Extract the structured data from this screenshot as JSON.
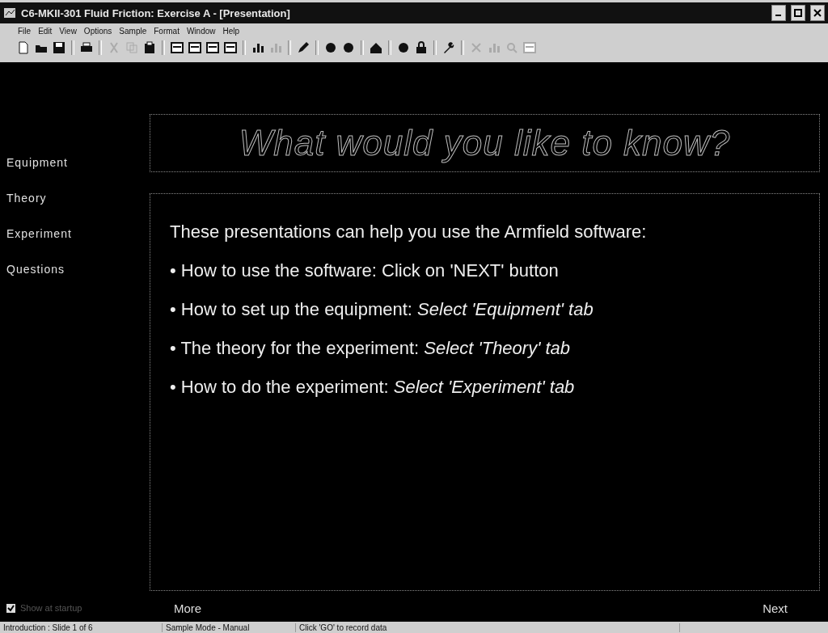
{
  "window": {
    "title": "C6-MKII-301 Fluid Friction:  Exercise A - [Presentation]"
  },
  "menu": [
    "File",
    "Edit",
    "View",
    "Options",
    "Sample",
    "Format",
    "Window",
    "Help"
  ],
  "toolbar": [
    {
      "kind": "page",
      "disabled": false
    },
    {
      "kind": "folder",
      "disabled": false
    },
    {
      "kind": "disk",
      "disabled": false
    },
    {
      "kind": "separator"
    },
    {
      "kind": "printer",
      "disabled": false
    },
    {
      "kind": "separator"
    },
    {
      "kind": "scissors",
      "disabled": true
    },
    {
      "kind": "copy",
      "disabled": true
    },
    {
      "kind": "paste",
      "disabled": false
    },
    {
      "kind": "separator"
    },
    {
      "kind": "window",
      "disabled": false
    },
    {
      "kind": "window",
      "disabled": false
    },
    {
      "kind": "window",
      "disabled": false
    },
    {
      "kind": "window",
      "disabled": false
    },
    {
      "kind": "separator"
    },
    {
      "kind": "bars",
      "disabled": false
    },
    {
      "kind": "bars",
      "disabled": true
    },
    {
      "kind": "separator"
    },
    {
      "kind": "pencil",
      "disabled": false
    },
    {
      "kind": "separator"
    },
    {
      "kind": "ball",
      "disabled": false
    },
    {
      "kind": "ball",
      "disabled": false
    },
    {
      "kind": "separator"
    },
    {
      "kind": "house",
      "disabled": false
    },
    {
      "kind": "separator"
    },
    {
      "kind": "ball",
      "disabled": false
    },
    {
      "kind": "lock",
      "disabled": false
    },
    {
      "kind": "separator"
    },
    {
      "kind": "wrench",
      "disabled": false
    },
    {
      "kind": "separator"
    },
    {
      "kind": "cross",
      "disabled": true
    },
    {
      "kind": "bars",
      "disabled": true
    },
    {
      "kind": "zoom",
      "disabled": true
    },
    {
      "kind": "window",
      "disabled": true
    }
  ],
  "sidebar": {
    "items": [
      "Equipment",
      "Theory",
      "Experiment",
      "Questions"
    ]
  },
  "heading": "What would you like to know?",
  "content": {
    "intro": "These presentations can help you use the Armfield software:",
    "bullets": [
      "• How to use the software: Click  on 'NEXT' button",
      "• How to set up the equipment: *Select 'Equipment' tab*",
      "• The theory for the experiment: *Select 'Theory' tab*",
      "• How to do the experiment: *Select 'Experiment' tab*"
    ]
  },
  "startup_checkbox": {
    "label": "Show at startup",
    "checked": true
  },
  "more_button": "More",
  "next_button": "Next",
  "status_bar": [
    "Introduction : Slide 1 of 6",
    "Sample Mode - Manual",
    "Click 'GO' to record data"
  ]
}
